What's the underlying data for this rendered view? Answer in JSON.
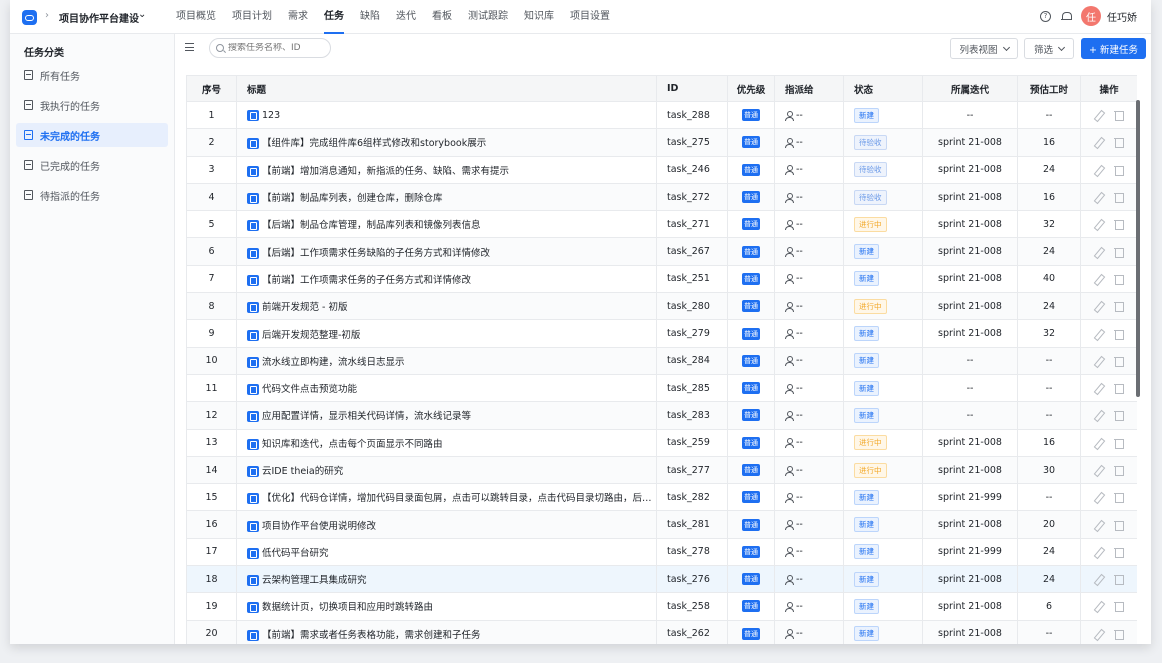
{
  "header": {
    "project_name": "项目协作平台建设",
    "nav": [
      "项目概览",
      "项目计划",
      "需求",
      "任务",
      "缺陷",
      "迭代",
      "看板",
      "测试跟踪",
      "知识库",
      "项目设置"
    ],
    "active_nav": "任务",
    "user_avatar_char": "任",
    "user_name": "任巧娇"
  },
  "sidebar": {
    "title": "任务分类",
    "items": [
      "所有任务",
      "我执行的任务",
      "未完成的任务",
      "已完成的任务",
      "待指派的任务"
    ],
    "active": "未完成的任务"
  },
  "toolbar": {
    "search_placeholder": "搜索任务名称、ID",
    "view_label": "列表视图",
    "filter_label": "筛选",
    "new_label": "+ 新建任务"
  },
  "table": {
    "columns": [
      "序号",
      "标题",
      "ID",
      "优先级",
      "指派给",
      "状态",
      "所属迭代",
      "预估工时",
      "操作"
    ],
    "priority_label": "普通",
    "assignee_label": "--",
    "rows": [
      {
        "no": "1",
        "title": "123",
        "id": "task_288",
        "status": "新建",
        "status_type": "new",
        "sprint": "--",
        "hours": "--"
      },
      {
        "no": "2",
        "title": "【组件库】完成组件库6组样式修改和storybook展示",
        "id": "task_275",
        "status": "待验收",
        "status_type": "wait",
        "sprint": "sprint 21-008",
        "hours": "16"
      },
      {
        "no": "3",
        "title": "【前端】增加消息通知，新指派的任务、缺陷、需求有提示",
        "id": "task_246",
        "status": "待验收",
        "status_type": "wait",
        "sprint": "sprint 21-008",
        "hours": "24"
      },
      {
        "no": "4",
        "title": "【前端】制品库列表，创建仓库，删除仓库",
        "id": "task_272",
        "status": "待验收",
        "status_type": "wait",
        "sprint": "sprint 21-008",
        "hours": "16"
      },
      {
        "no": "5",
        "title": "【后端】制品仓库管理，制品库列表和镜像列表信息",
        "id": "task_271",
        "status": "进行中",
        "status_type": "prog",
        "sprint": "sprint 21-008",
        "hours": "32"
      },
      {
        "no": "6",
        "title": "【后端】工作项需求任务缺陷的子任务方式和详情修改",
        "id": "task_267",
        "status": "新建",
        "status_type": "new",
        "sprint": "sprint 21-008",
        "hours": "24"
      },
      {
        "no": "7",
        "title": "【前端】工作项需求任务的子任务方式和详情修改",
        "id": "task_251",
        "status": "新建",
        "status_type": "new",
        "sprint": "sprint 21-008",
        "hours": "40"
      },
      {
        "no": "8",
        "title": "前端开发规范 - 初版",
        "id": "task_280",
        "status": "进行中",
        "status_type": "prog",
        "sprint": "sprint 21-008",
        "hours": "24"
      },
      {
        "no": "9",
        "title": "后端开发规范整理-初版",
        "id": "task_279",
        "status": "新建",
        "status_type": "new",
        "sprint": "sprint 21-008",
        "hours": "32"
      },
      {
        "no": "10",
        "title": "流水线立即构建，流水线日志显示",
        "id": "task_284",
        "status": "新建",
        "status_type": "new",
        "sprint": "--",
        "hours": "--"
      },
      {
        "no": "11",
        "title": "代码文件点击预览功能",
        "id": "task_285",
        "status": "新建",
        "status_type": "new",
        "sprint": "--",
        "hours": "--"
      },
      {
        "no": "12",
        "title": "应用配置详情，显示相关代码详情，流水线记录等",
        "id": "task_283",
        "status": "新建",
        "status_type": "new",
        "sprint": "--",
        "hours": "--"
      },
      {
        "no": "13",
        "title": "知识库和迭代，点击每个页面显示不同路由",
        "id": "task_259",
        "status": "进行中",
        "status_type": "prog",
        "sprint": "sprint 21-008",
        "hours": "16"
      },
      {
        "no": "14",
        "title": "云IDE theia的研究",
        "id": "task_277",
        "status": "进行中",
        "status_type": "prog",
        "sprint": "sprint 21-008",
        "hours": "30"
      },
      {
        "no": "15",
        "title": "【优化】代码仓详情，增加代码目录面包屑，点击可以跳转目录，点击代码目录切路由，后退可...",
        "id": "task_282",
        "status": "新建",
        "status_type": "new",
        "sprint": "sprint 21-999",
        "hours": "--"
      },
      {
        "no": "16",
        "title": "项目协作平台使用说明修改",
        "id": "task_281",
        "status": "新建",
        "status_type": "new",
        "sprint": "sprint 21-008",
        "hours": "20"
      },
      {
        "no": "17",
        "title": "低代码平台研究",
        "id": "task_278",
        "status": "新建",
        "status_type": "new",
        "sprint": "sprint 21-999",
        "hours": "24"
      },
      {
        "no": "18",
        "title": "云架构管理工具集成研究",
        "id": "task_276",
        "status": "新建",
        "status_type": "new",
        "sprint": "sprint 21-008",
        "hours": "24"
      },
      {
        "no": "19",
        "title": "数据统计页，切换项目和应用时跳转路由",
        "id": "task_258",
        "status": "新建",
        "status_type": "new",
        "sprint": "sprint 21-008",
        "hours": "6"
      },
      {
        "no": "20",
        "title": "【前端】需求或者任务表格功能，需求创建和子任务",
        "id": "task_262",
        "status": "新建",
        "status_type": "new",
        "sprint": "sprint 21-008",
        "hours": "--"
      }
    ],
    "highlight_row": "18"
  }
}
